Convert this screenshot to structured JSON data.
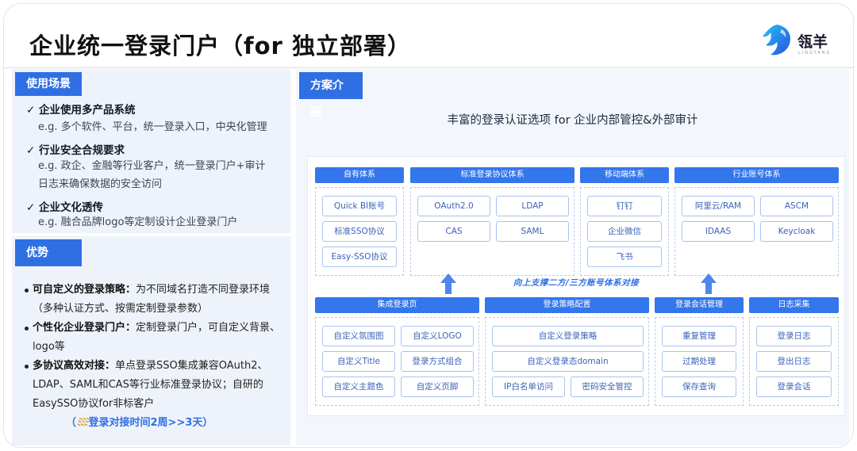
{
  "title": "企业统一登录门户（for 独立部署）",
  "logo": {
    "name": "瓴羊",
    "sub": "LINGYANG",
    "brand_color": "#2f6fe4"
  },
  "usage": {
    "tag": "使用场景",
    "items": [
      {
        "check": "✓",
        "title": "企业使用多产品系统",
        "examples": [
          "e.g. 多个软件、平台，统一登录入口，中央化管理"
        ]
      },
      {
        "check": "✓",
        "title": "行业安全合规要求",
        "examples": [
          "e.g. 政企、金融等行业客户，统一登录门户+审计",
          "日志来确保数据的安全访问"
        ]
      },
      {
        "check": "✓",
        "title": "企业文化透传",
        "examples": [
          "e.g. 融合品牌logo等定制设计企业登录门户"
        ]
      }
    ]
  },
  "advantages": {
    "tag": "优势",
    "items": [
      {
        "bold": "可自定义的登录策略：",
        "text": "为不同域名打造不同登录环境（多种认证方式、按需定制登录参数）"
      },
      {
        "bold": "个性化企业登录门户：",
        "text": "定制登录门户，可自定义背景、logo等"
      },
      {
        "bold": "多协议高效对接：",
        "text": "单点登录SSO集成兼容OAuth2、LDAP、SAML和CAS等行业标准登录协议；自研的EasySSO协议for非标客户"
      }
    ],
    "footer_open": "（",
    "footer_spark": "ﾐﾐﾐ",
    "footer_text": "登录对接时间2周>>3天）"
  },
  "solution": {
    "tag": "方案介绍",
    "subtitle": "丰富的登录认证选项 for 企业内部管控&外部审计",
    "top_groups": [
      {
        "header": "自有体系",
        "items": [
          "Quick BI账号",
          "标准SSO协议",
          "Easy-SSO协议"
        ]
      },
      {
        "header": "标准登录协议体系",
        "items": [
          "OAuth2.0",
          "LDAP",
          "CAS",
          "SAML"
        ]
      },
      {
        "header": "移动端体系",
        "items": [
          "钉钉",
          "企业微信",
          "飞书"
        ]
      },
      {
        "header": "行业账号体系",
        "items": [
          "阿里云/RAM",
          "ASCM",
          "IDAAS",
          "Keycloak"
        ]
      }
    ],
    "middle_text": "向上支撑二方/三方账号体系对接",
    "bottom_groups": [
      {
        "header": "集成登录页",
        "items": [
          "自定义氛围图",
          "自定义LOGO",
          "自定义Title",
          "登录方式组合",
          "自定义主题色",
          "自定义页脚"
        ]
      },
      {
        "header": "登录策略配置",
        "items": [
          "自定义登录策略",
          "自定义登录态domain",
          "IP白名单访问",
          "密码安全管控"
        ]
      },
      {
        "header": "登录会话管理",
        "items": [
          "重复管理",
          "过期处理",
          "保存查询"
        ]
      },
      {
        "header": "日志采集",
        "items": [
          "登录日志",
          "登出日志",
          "登录会话"
        ]
      }
    ]
  }
}
